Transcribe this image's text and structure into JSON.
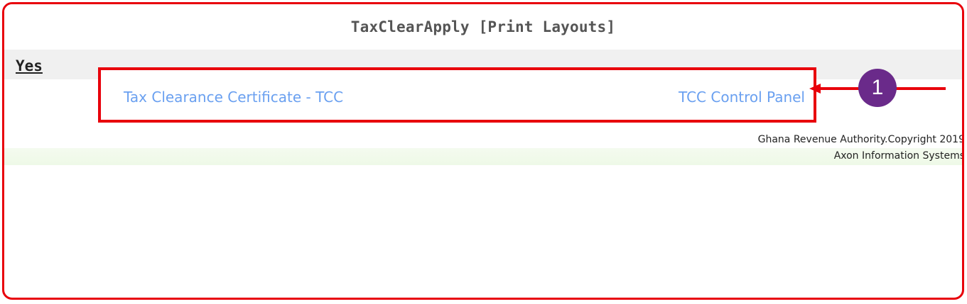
{
  "page": {
    "title": "TaxClearApply [Print Layouts]",
    "section_label": "Yes"
  },
  "links": {
    "left": "Tax Clearance Certificate - TCC",
    "right": "TCC Control Panel"
  },
  "annotation": {
    "badge_number": "1",
    "colors": {
      "highlight": "#e8000b",
      "badge": "#6a2a8a",
      "link": "#6aa0f0"
    }
  },
  "footer": {
    "line1": "Ghana Revenue Authority.Copyright 2019",
    "line2": "Axon Information Systems"
  }
}
